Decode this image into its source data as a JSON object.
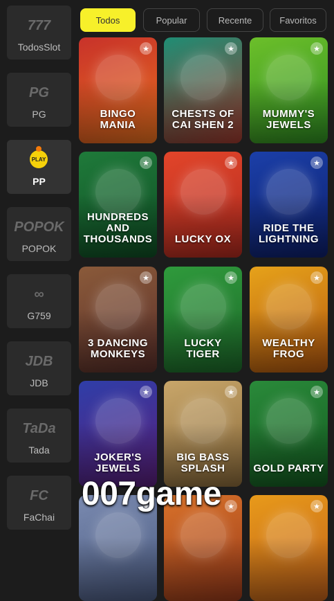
{
  "sidebar": {
    "providers": [
      {
        "label": "TodosSlot",
        "logo": "777",
        "icon": "slot-777-icon"
      },
      {
        "label": "PG",
        "logo": "PG",
        "icon": "pg-logo"
      },
      {
        "label": "PP",
        "logo": "PLAY",
        "icon": "pragmatic-play-logo",
        "active": true
      },
      {
        "label": "POPOK",
        "logo": "POPOK",
        "icon": "popok-logo"
      },
      {
        "label": "G759",
        "logo": "∞",
        "icon": "g759-logo"
      },
      {
        "label": "JDB",
        "logo": "JDB",
        "icon": "jdb-logo"
      },
      {
        "label": "Tada",
        "logo": "TaDa",
        "icon": "tada-logo"
      },
      {
        "label": "FaChai",
        "logo": "FC",
        "icon": "fachai-logo"
      }
    ]
  },
  "tabs": [
    {
      "label": "Todos",
      "active": true
    },
    {
      "label": "Popular"
    },
    {
      "label": "Recente"
    },
    {
      "label": "Favoritos"
    }
  ],
  "games": [
    {
      "title": "BINGO MANIA",
      "bg": "#c8322a",
      "bg2": "#e8701e"
    },
    {
      "title": "CHESTS OF CAI SHEN 2",
      "bg": "#1f8d74",
      "bg2": "#a0392e"
    },
    {
      "title": "MUMMY'S JEWELS",
      "bg": "#6cbf2a",
      "bg2": "#2f8e22"
    },
    {
      "title": "HUNDREDS AND THOUSANDS",
      "bg": "#1f7a3a",
      "bg2": "#0f4d24"
    },
    {
      "title": "LUCKY OX",
      "bg": "#e2452a",
      "bg2": "#b02a1f"
    },
    {
      "title": "RIDE THE LIGHTNING",
      "bg": "#1b3fa8",
      "bg2": "#0d1f6b"
    },
    {
      "title": "3 DANCING MONKEYS",
      "bg": "#8a5a3a",
      "bg2": "#5a2f2a"
    },
    {
      "title": "LUCKY TIGER",
      "bg": "#2f9a3c",
      "bg2": "#1d6a2a"
    },
    {
      "title": "WEALTHY FROG",
      "bg": "#e6a21a",
      "bg2": "#b5580f"
    },
    {
      "title": "JOKER'S JEWELS",
      "bg": "#2f3ea8",
      "bg2": "#5a1f7a"
    },
    {
      "title": "BIG BASS SPLASH",
      "bg": "#c8a66a",
      "bg2": "#8a6a3a"
    },
    {
      "title": "GOLD PARTY",
      "bg": "#2a8a3a",
      "bg2": "#135a20"
    },
    {
      "title": "",
      "bg": "#7a8ab0",
      "bg2": "#4a5a80"
    },
    {
      "title": "",
      "bg": "#d8722a",
      "bg2": "#9a3a1a"
    },
    {
      "title": "",
      "bg": "#e89a1a",
      "bg2": "#c0601a"
    }
  ],
  "fav_icon": "star-icon",
  "watermark": "007game"
}
